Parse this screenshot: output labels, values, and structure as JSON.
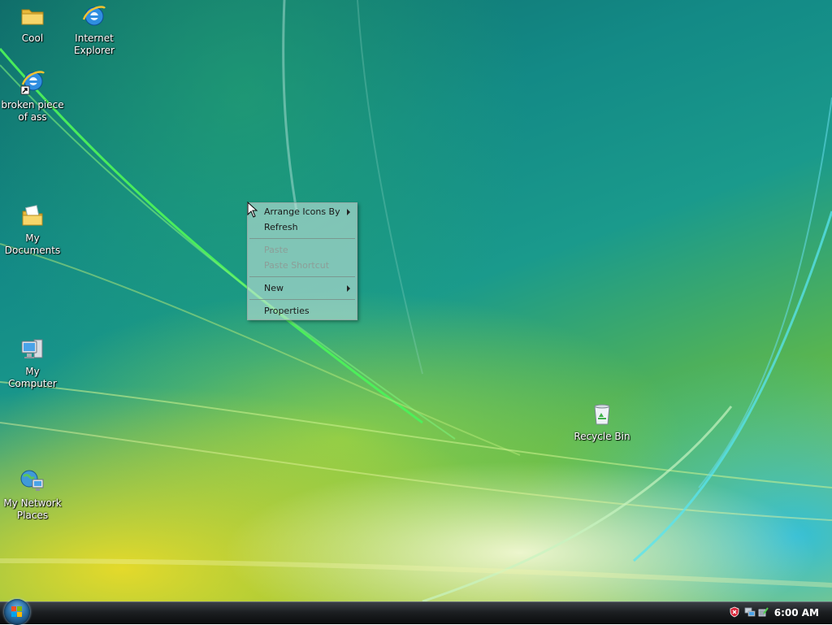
{
  "desktop": {
    "icons": [
      {
        "label": "Cool",
        "icon": "folder-icon"
      },
      {
        "label": "Internet\nExplorer",
        "icon": "internet-explorer-icon"
      },
      {
        "label": "broken piece\nof ass",
        "icon": "internet-explorer-shortcut-icon"
      },
      {
        "label": "My\nDocuments",
        "icon": "my-documents-icon"
      },
      {
        "label": "My Computer",
        "icon": "my-computer-icon"
      },
      {
        "label": "My Network\nPlaces",
        "icon": "network-places-icon"
      },
      {
        "label": "Recycle Bin",
        "icon": "recycle-bin-icon"
      }
    ]
  },
  "context_menu": {
    "items": [
      {
        "label": "Arrange Icons By",
        "submenu": true,
        "enabled": true
      },
      {
        "label": "Refresh",
        "submenu": false,
        "enabled": true
      },
      {
        "label": "Paste",
        "submenu": false,
        "enabled": false
      },
      {
        "label": "Paste Shortcut",
        "submenu": false,
        "enabled": false
      },
      {
        "label": "New",
        "submenu": true,
        "enabled": true
      },
      {
        "label": "Properties",
        "submenu": false,
        "enabled": true
      }
    ]
  },
  "taskbar": {
    "start_icon": "windows-orb-icon",
    "tray_icons": [
      "security-shield-icon",
      "network-icon",
      "safely-remove-hardware-icon"
    ],
    "clock": "6:00 AM"
  }
}
